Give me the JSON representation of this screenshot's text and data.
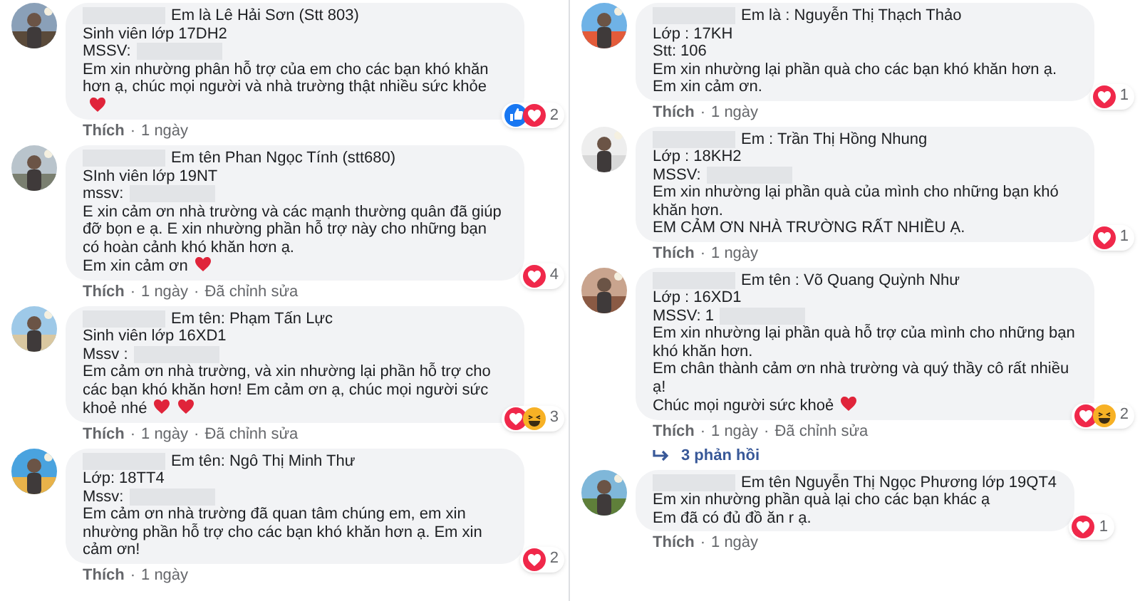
{
  "columns": [
    {
      "comments": [
        {
          "name": "Em là Lê Hải Sơn (Stt 803)",
          "lines": [
            {
              "text": "Sinh viên lớp 17DH2"
            },
            {
              "text": "MSSV:",
              "redacted": true
            },
            {
              "text": "Em xin nhường phân hỗ trợ của em cho các bạn khó khăn hơn ạ, chúc mọi người và nhà trường thật nhiều sức khỏe",
              "hearts": [
                {
                  "kind": "heart"
                }
              ]
            }
          ],
          "reactions": [
            {
              "kind": "like"
            },
            {
              "kind": "love"
            }
          ],
          "reaction_count": "2",
          "meta": [
            "Thích",
            "1 ngày"
          ],
          "separator": "·"
        },
        {
          "name": "Em tên Phan Ngọc Tính (stt680)",
          "lines": [
            {
              "text": "SInh viên lớp 19NT"
            },
            {
              "text": "mssv:",
              "redacted": true
            },
            {
              "text": "E xin cảm ơn nhà trường và các mạnh thường quân đã giúp đỡ bọn e ạ. E xin nhường phần hỗ trợ này cho những bạn có hoàn cảnh khó khăn hơn ạ."
            },
            {
              "text": "Em xin cảm ơn",
              "hearts": [
                {
                  "kind": "heart"
                }
              ]
            }
          ],
          "reactions": [
            {
              "kind": "love"
            }
          ],
          "reaction_count": "4",
          "meta": [
            "Thích",
            "1 ngày",
            "Đã chỉnh sửa"
          ],
          "separator": "·"
        },
        {
          "name": "Em tên: Phạm Tấn Lực",
          "lines": [
            {
              "text": "Sinh viên lớp 16XD1"
            },
            {
              "text": "Mssv :",
              "redacted": true
            },
            {
              "text": "Em cảm ơn nhà trường, và xin nhường lại phần hỗ trợ cho các bạn khó khăn hơn! Em cảm ơn ạ, chúc mọi người sức khoẻ nhé",
              "hearts": [
                {
                  "kind": "heart"
                },
                {
                  "kind": "heart"
                }
              ]
            }
          ],
          "reactions": [
            {
              "kind": "love"
            },
            {
              "kind": "haha"
            }
          ],
          "reaction_count": "3",
          "meta": [
            "Thích",
            "1 ngày",
            "Đã chỉnh sửa"
          ],
          "separator": "·"
        },
        {
          "name": "Em tên: Ngô Thị Minh Thư",
          "lines": [
            {
              "text": "Lớp: 18TT4"
            },
            {
              "text": "Mssv:",
              "redacted": true
            },
            {
              "text": "Em cảm ơn nhà trường đã quan tâm chúng em, em xin nhường phần hỗ trợ cho các bạn khó khăn hơn ạ. Em xin cảm ơn!"
            }
          ],
          "reactions": [
            {
              "kind": "love"
            }
          ],
          "reaction_count": "2",
          "meta": [
            "Thích",
            "1 ngày"
          ],
          "separator": "·"
        }
      ]
    },
    {
      "comments": [
        {
          "name": "Em là : Nguyễn Thị Thạch Thảo",
          "lines": [
            {
              "text": "Lớp : 17KH"
            },
            {
              "text": "Stt: 106"
            },
            {
              "text": "Em xin nhường lại phần quà cho các bạn khó khăn hơn ạ. Em xin cảm ơn."
            }
          ],
          "reactions": [
            {
              "kind": "love"
            }
          ],
          "reaction_count": "1",
          "meta": [
            "Thích",
            "1 ngày"
          ],
          "separator": "·"
        },
        {
          "name": "Em : Trần Thị Hồng Nhung",
          "lines": [
            {
              "text": "Lớp : 18KH2"
            },
            {
              "text": "MSSV:",
              "redacted": true
            },
            {
              "text": "Em xin nhường lại phần quà của mình cho những bạn khó khăn hơn."
            },
            {
              "text": "EM CẢM ƠN NHÀ TRƯỜNG RẤT NHIỀU Ạ."
            }
          ],
          "reactions": [
            {
              "kind": "love"
            }
          ],
          "reaction_count": "1",
          "meta": [
            "Thích",
            "1 ngày"
          ],
          "separator": "·"
        },
        {
          "name": "Em tên : Võ Quang Quỳnh Như",
          "lines": [
            {
              "text": "Lớp : 16XD1"
            },
            {
              "text": "MSSV: 1",
              "redacted": true
            },
            {
              "text": "Em xin nhường lại phần quà hỗ trợ của mình cho những bạn khó khăn hơn."
            },
            {
              "text": "Em chân thành cảm ơn nhà trường và quý thầy cô rất nhiều ạ!"
            },
            {
              "text": "Chúc mọi người sức khoẻ",
              "hearts": [
                {
                  "kind": "heart"
                }
              ]
            }
          ],
          "reactions": [
            {
              "kind": "love"
            },
            {
              "kind": "haha"
            }
          ],
          "reaction_count": "2",
          "meta": [
            "Thích",
            "1 ngày",
            "Đã chỉnh sửa"
          ],
          "separator": "·",
          "replies": "3 phản hồi"
        },
        {
          "name": "Em tên Nguyễn Thị Ngọc Phương lớp 19QT4",
          "lines": [
            {
              "text": "Em xin nhường phần quà lại cho các bạn khác ạ"
            },
            {
              "text": "Em đã có đủ đồ ăn r ạ."
            }
          ],
          "reactions": [
            {
              "kind": "love"
            }
          ],
          "reaction_count": "1",
          "meta": [
            "Thích",
            "1 ngày"
          ],
          "separator": "·"
        }
      ]
    }
  ]
}
